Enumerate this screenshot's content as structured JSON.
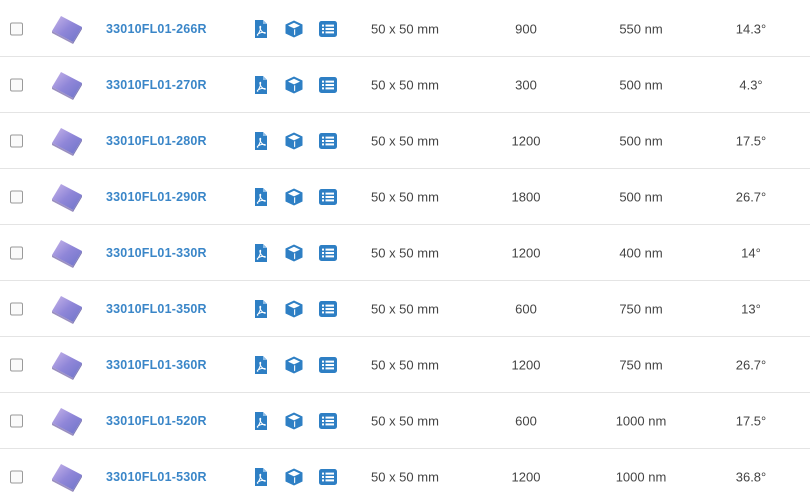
{
  "colors": {
    "accent": "#3a86c8",
    "text": "#444444",
    "divider": "#e4e4e4"
  },
  "icons": {
    "datasheet": "pdf-icon",
    "model": "cube-icon",
    "specs": "list-icon"
  },
  "rows": [
    {
      "part": "33010FL01-266R",
      "size": "50 x 50 mm",
      "grooves": "900",
      "wavelength": "550 nm",
      "angle": "14.3°"
    },
    {
      "part": "33010FL01-270R",
      "size": "50 x 50 mm",
      "grooves": "300",
      "wavelength": "500 nm",
      "angle": "4.3°"
    },
    {
      "part": "33010FL01-280R",
      "size": "50 x 50 mm",
      "grooves": "1200",
      "wavelength": "500 nm",
      "angle": "17.5°"
    },
    {
      "part": "33010FL01-290R",
      "size": "50 x 50 mm",
      "grooves": "1800",
      "wavelength": "500 nm",
      "angle": "26.7°"
    },
    {
      "part": "33010FL01-330R",
      "size": "50 x 50 mm",
      "grooves": "1200",
      "wavelength": "400 nm",
      "angle": "14°"
    },
    {
      "part": "33010FL01-350R",
      "size": "50 x 50 mm",
      "grooves": "600",
      "wavelength": "750 nm",
      "angle": "13°"
    },
    {
      "part": "33010FL01-360R",
      "size": "50 x 50 mm",
      "grooves": "1200",
      "wavelength": "750 nm",
      "angle": "26.7°"
    },
    {
      "part": "33010FL01-520R",
      "size": "50 x 50 mm",
      "grooves": "600",
      "wavelength": "1000 nm",
      "angle": "17.5°"
    },
    {
      "part": "33010FL01-530R",
      "size": "50 x 50 mm",
      "grooves": "1200",
      "wavelength": "1000 nm",
      "angle": "36.8°"
    }
  ]
}
